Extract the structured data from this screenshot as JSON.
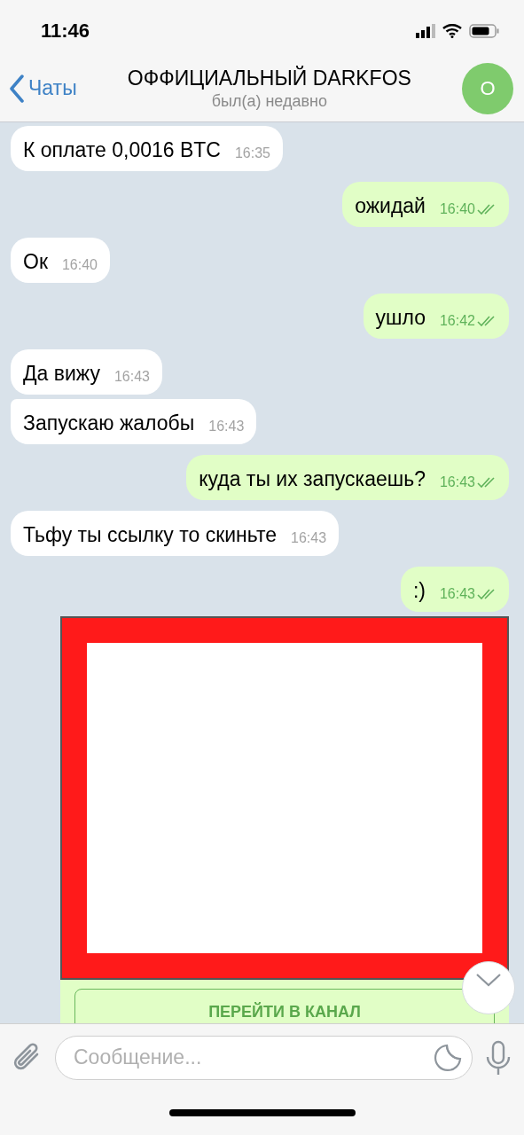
{
  "status_bar": {
    "time": "11:46"
  },
  "header": {
    "back_label": "Чаты",
    "title": "ОФФИЦИАЛЬНЫЙ DARKFOS",
    "subtitle": "был(а) недавно",
    "avatar_letter": "O"
  },
  "messages": [
    {
      "kind": "text",
      "outgoing": false,
      "text": "К оплате 0,0016 BTC",
      "time": "16:35",
      "grouped": false
    },
    {
      "kind": "text",
      "outgoing": true,
      "text": "ожидай",
      "time": "16:40",
      "read": true,
      "grouped": false
    },
    {
      "kind": "text",
      "outgoing": false,
      "text": "Ок",
      "time": "16:40",
      "grouped": false
    },
    {
      "kind": "text",
      "outgoing": true,
      "text": "ушло",
      "time": "16:42",
      "read": true,
      "grouped": false
    },
    {
      "kind": "text",
      "outgoing": false,
      "text": "Да вижу",
      "time": "16:43",
      "grouped": false
    },
    {
      "kind": "text",
      "outgoing": false,
      "text": "Запускаю жалобы",
      "time": "16:43",
      "grouped": true
    },
    {
      "kind": "text",
      "outgoing": true,
      "text": "куда ты их запускаешь?",
      "time": "16:43",
      "read": true,
      "grouped": false
    },
    {
      "kind": "text",
      "outgoing": false,
      "text": "Тьфу ты ссылку то скиньте",
      "time": "16:43",
      "grouped": false
    },
    {
      "kind": "text",
      "outgoing": true,
      "text": ":)",
      "time": "16:43",
      "read": true,
      "grouped": false
    },
    {
      "kind": "media",
      "outgoing": true,
      "button": "ПЕРЕЙТИ В КАНАЛ",
      "grouped": true
    }
  ],
  "composer": {
    "placeholder": "Сообщение..."
  }
}
